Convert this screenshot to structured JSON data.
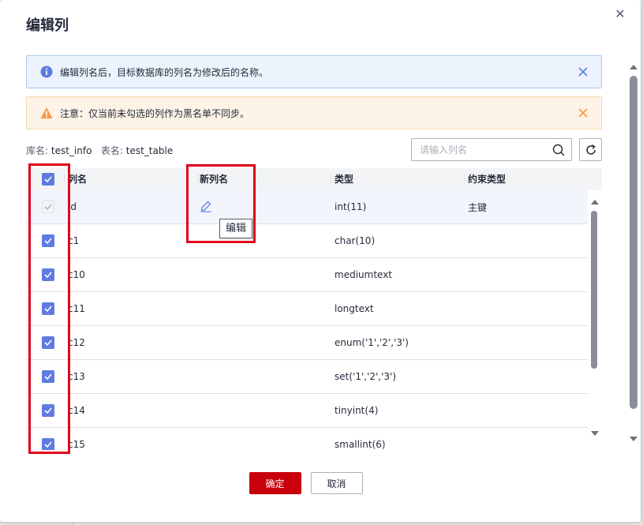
{
  "dialog": {
    "title": "编辑列",
    "close_glyph": "✕"
  },
  "alerts": {
    "info": {
      "text": "编辑列名后，目标数据库的列名为修改后的名称。",
      "color": "#5e7ce0"
    },
    "warn": {
      "text": "注意：仅当前未勾选的列作为黑名单不同步。",
      "color": "#fa9841"
    }
  },
  "dbinfo": {
    "db_label": "库名:",
    "db_value": "test_info",
    "table_label": "表名:",
    "table_value": "test_table"
  },
  "search": {
    "placeholder": "请输入列名"
  },
  "table": {
    "headers": {
      "name": "列名",
      "new_name": "新列名",
      "type": "类型",
      "constraint": "约束类型"
    },
    "rows": [
      {
        "name": "id",
        "new_name": "",
        "type": "int(11)",
        "constraint": "主键"
      },
      {
        "name": "c1",
        "new_name": "",
        "type": "char(10)",
        "constraint": ""
      },
      {
        "name": "c10",
        "new_name": "",
        "type": "mediumtext",
        "constraint": ""
      },
      {
        "name": "c11",
        "new_name": "",
        "type": "longtext",
        "constraint": ""
      },
      {
        "name": "c12",
        "new_name": "",
        "type": "enum('1','2','3')",
        "constraint": ""
      },
      {
        "name": "c13",
        "new_name": "",
        "type": "set('1','2','3')",
        "constraint": ""
      },
      {
        "name": "c14",
        "new_name": "",
        "type": "tinyint(4)",
        "constraint": ""
      },
      {
        "name": "c15",
        "new_name": "",
        "type": "smallint(6)",
        "constraint": ""
      }
    ]
  },
  "tooltip": {
    "text": "编辑"
  },
  "footer": {
    "confirm": "确定",
    "cancel": "取消"
  },
  "colors": {
    "accent": "#5e7ce0",
    "primary_button": "#c7000b",
    "highlight_box": "#e0001b"
  }
}
